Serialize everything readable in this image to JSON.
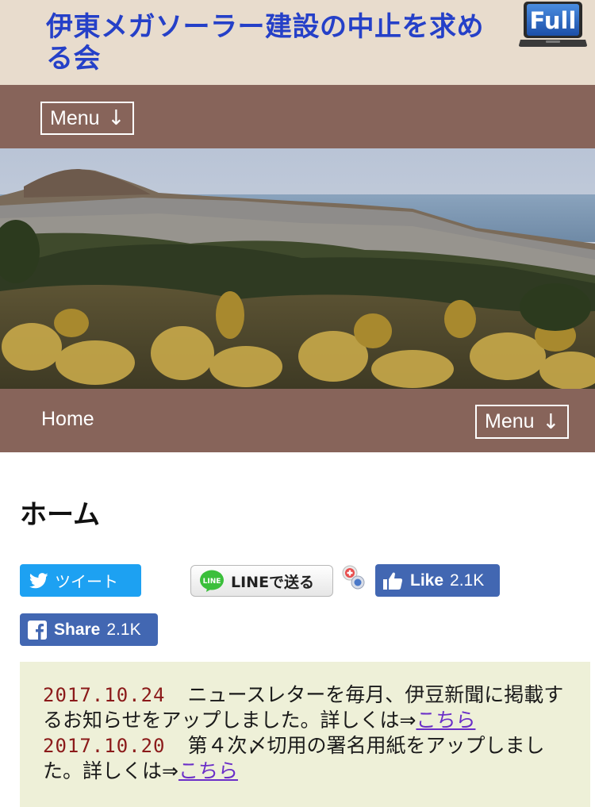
{
  "header": {
    "site_title": "伊東メガソーラー建設の中止を求める会",
    "full_label": "Full"
  },
  "nav": {
    "menu_label": "Menu",
    "menu_arrow": "↓",
    "home_label": "Home"
  },
  "page": {
    "title": "ホーム"
  },
  "share": {
    "tweet_label": "ツイート",
    "line_label": "LINEで送る",
    "line_icon_text": "LINE",
    "like_label": "Like",
    "like_count": "2.1K",
    "share_label": "Share",
    "share_count": "2.1K"
  },
  "news": [
    {
      "date": "2017.10.24",
      "text": "ニュースレターを毎月、伊豆新聞に掲載するお知らせをアップしました。詳しくは⇒",
      "link": "こちら"
    },
    {
      "date": "2017.10.20",
      "text": "第４次〆切用の署名用紙をアップしました。詳しくは⇒",
      "link": "こちら"
    }
  ],
  "colors": {
    "header_bg": "#e8dccd",
    "title_blue": "#2540c8",
    "nav_brown": "#87645a",
    "date_red": "#8b1a1a",
    "link_purple": "#6a2ec8",
    "news_bg": "#eef0d8",
    "twitter_blue": "#1da1f2",
    "facebook_blue": "#4267b2"
  },
  "icons": [
    "laptop-full-icon",
    "twitter-bird-icon",
    "line-icon",
    "hatena-bookmark-icon",
    "thumbs-up-icon",
    "facebook-f-icon"
  ]
}
